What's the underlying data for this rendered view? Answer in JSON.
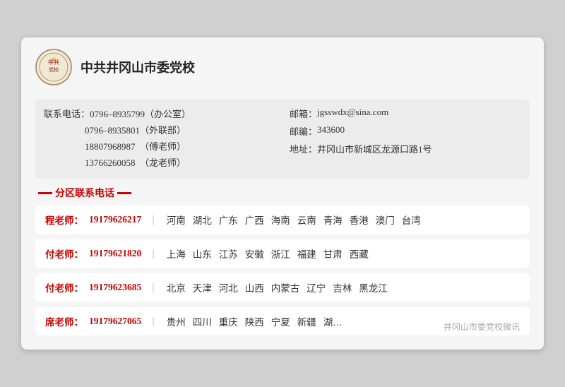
{
  "header": {
    "school_name": "中共井冈山市委党校",
    "logo_alt": "school-logo"
  },
  "contact": {
    "left": {
      "label1": "联系电话：",
      "phone1": "0796–8935799",
      "note1": "（办公室）",
      "phone2": "0796–8935801",
      "note2": "（外联部）",
      "phone3": "18807968987",
      "note3": "（傅老师）",
      "phone4": "13766260058",
      "note4": "（龙老师）"
    },
    "right": {
      "email_label": "邮箱：",
      "email": "jgsswdx@sina.com",
      "postal_label": "邮编：",
      "postal": "343600",
      "address_label": "地址：",
      "address": "井冈山市新城区龙源口路1号"
    }
  },
  "section_title": "分区联系电话",
  "regions": [
    {
      "teacher_label": "程老师：",
      "phone": "19179626217",
      "areas": [
        "河南",
        "湖北",
        "广东",
        "广西",
        "海南",
        "云南",
        "青海",
        "香港",
        "澳门",
        "台湾"
      ]
    },
    {
      "teacher_label": "付老师：",
      "phone": "19179621820",
      "areas": [
        "上海",
        "山东",
        "江苏",
        "安徽",
        "浙江",
        "福建",
        "甘肃",
        "西藏"
      ]
    },
    {
      "teacher_label": "付老师：",
      "phone": "19179623685",
      "areas": [
        "北京",
        "天津",
        "河北",
        "山西",
        "内蒙古",
        "辽宁",
        "吉林",
        "黑龙江"
      ]
    },
    {
      "teacher_label": "席老师：",
      "phone": "19179627065",
      "areas": [
        "贵州",
        "四川",
        "重庆",
        "陕西",
        "宁夏",
        "新疆",
        "湖…"
      ]
    }
  ],
  "watermark": "井冈山市委党校微讯"
}
